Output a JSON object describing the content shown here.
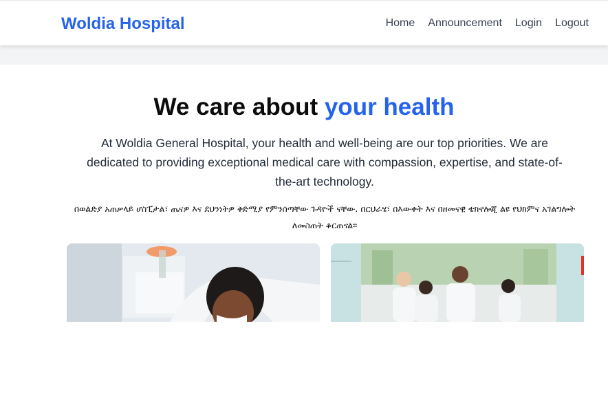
{
  "navbar": {
    "brand": "Woldia Hospital",
    "links": [
      "Home",
      "Announcement",
      "Login",
      "Logout"
    ]
  },
  "hero": {
    "title_prefix": "We care about",
    "title_accent": "your health",
    "description": "At Woldia General Hospital, your health and well-being are our top priorities. We are dedicated to providing exceptional medical care with compassion, expertise, and state-of-the-art technology.",
    "description_amharic": "በወልድያ አጠቃላይ ሆስፒታል፣ ጤናዎ እና ደህንነትዎ ቅድሚያ የምንሰጣቸው ጉዳዮች ናቸው. በርህራሄ፣ በእውቀት እና በዘመናዊ ቴክኖሎጂ ልዩ የህክምና አገልግሎት ለመስጠት ቆርጠናል።"
  },
  "colors": {
    "brand": "#2563eb",
    "nav_text": "#374151",
    "band": "#f3f4f6"
  },
  "images": [
    {
      "name": "child-patient-photo"
    },
    {
      "name": "doctors-team-photo"
    }
  ]
}
